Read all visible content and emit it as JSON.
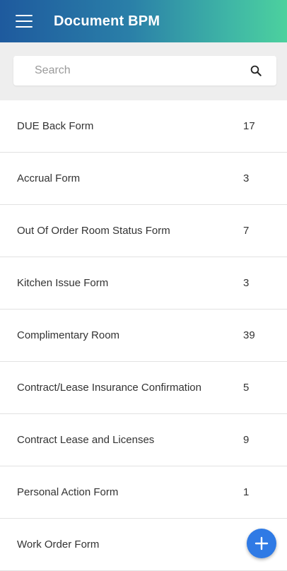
{
  "app": {
    "title": "Document BPM"
  },
  "search": {
    "placeholder": "Search"
  },
  "forms": [
    {
      "label": "DUE Back Form",
      "count": "17"
    },
    {
      "label": "Accrual Form",
      "count": "3"
    },
    {
      "label": "Out Of Order Room Status Form",
      "count": "7"
    },
    {
      "label": "Kitchen Issue Form",
      "count": "3"
    },
    {
      "label": "Complimentary Room",
      "count": "39"
    },
    {
      "label": "Contract/Lease Insurance Confirmation",
      "count": "5"
    },
    {
      "label": "Contract Lease and Licenses",
      "count": "9"
    },
    {
      "label": "Personal Action Form",
      "count": "1"
    },
    {
      "label": "Work Order Form",
      "count": ""
    }
  ],
  "icons": {
    "menu": "menu-icon",
    "search": "search-icon",
    "fab": "plus-icon"
  },
  "colors": {
    "accent": "#2f7ae5",
    "header_start": "#1e5a9e",
    "header_end": "#4cd19e"
  }
}
